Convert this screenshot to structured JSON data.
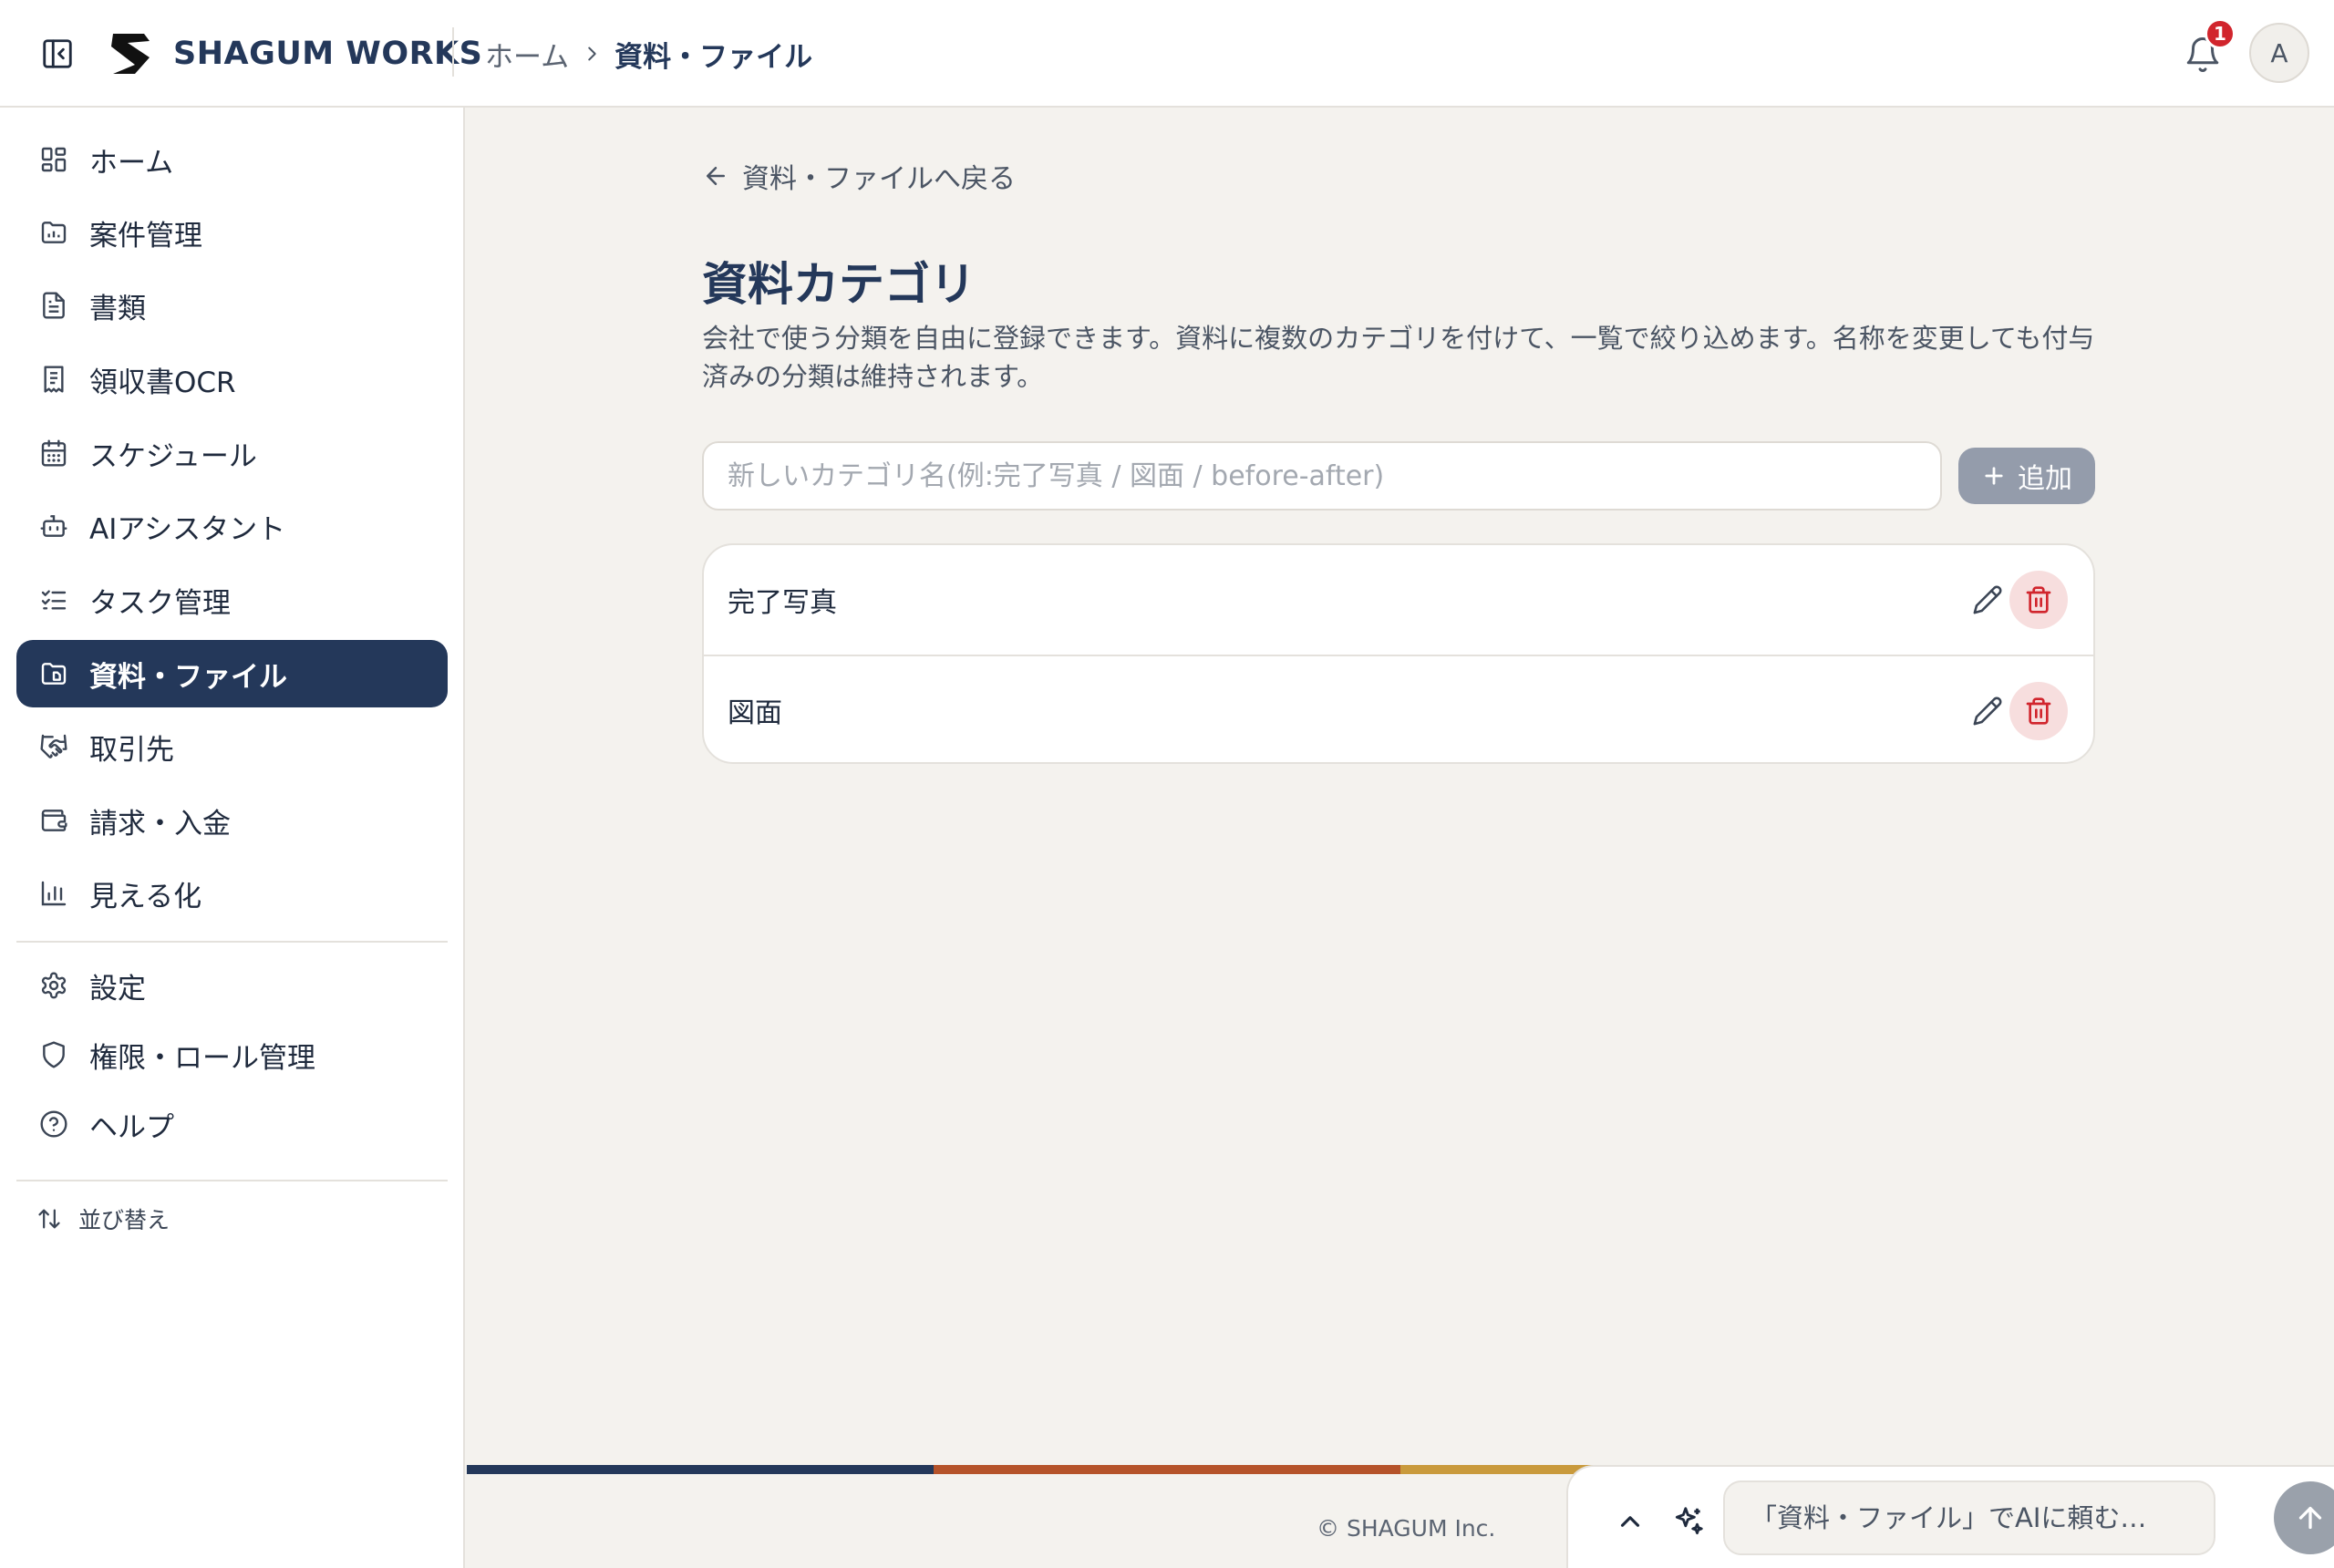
{
  "header": {
    "brand_name": "SHAGUM WORKS",
    "breadcrumb": [
      "ホーム",
      "資料・ファイル"
    ],
    "notification_count": "1",
    "avatar_initial": "A"
  },
  "sidebar": {
    "items": [
      {
        "label": "ホーム",
        "icon": "dashboard-icon"
      },
      {
        "label": "案件管理",
        "icon": "folder-chart-icon"
      },
      {
        "label": "書類",
        "icon": "document-icon"
      },
      {
        "label": "領収書OCR",
        "icon": "receipt-icon"
      },
      {
        "label": "スケジュール",
        "icon": "calendar-icon"
      },
      {
        "label": "AIアシスタント",
        "icon": "bot-icon"
      },
      {
        "label": "タスク管理",
        "icon": "checklist-icon"
      },
      {
        "label": "資料・ファイル",
        "icon": "folder-file-icon",
        "active": true
      },
      {
        "label": "取引先",
        "icon": "handshake-icon"
      },
      {
        "label": "請求・入金",
        "icon": "wallet-icon"
      },
      {
        "label": "見える化",
        "icon": "bar-chart-icon"
      }
    ],
    "secondary_items": [
      {
        "label": "設定",
        "icon": "gear-icon"
      },
      {
        "label": "権限・ロール管理",
        "icon": "shield-icon"
      },
      {
        "label": "ヘルプ",
        "icon": "help-circle-icon"
      }
    ],
    "sort_label": "並び替え"
  },
  "main": {
    "back_link": "資料・ファイルへ戻る",
    "title": "資料カテゴリ",
    "description": "会社で使う分類を自由に登録できます。資料に複数のカテゴリを付けて、一覧で絞り込めます。名称を変更しても付与済みの分類は維持されます。",
    "new_category_placeholder": "新しいカテゴリ名(例:完了写真 / 図面 / before-after)",
    "new_category_value": "",
    "add_label": "追加",
    "categories": [
      {
        "name": "完了写真"
      },
      {
        "name": "図面"
      }
    ]
  },
  "footer": {
    "copyright": "© SHAGUM Inc.",
    "stripe_colors": [
      "#24385a",
      "#b5532a",
      "#c99a3c"
    ]
  },
  "ai_bar": {
    "placeholder": "「資料・ファイル」でAIに頼む…"
  },
  "colors": {
    "primary": "#24385a",
    "danger": "#d1252d",
    "danger_bg": "#f7dede",
    "background": "#f4f2ee"
  }
}
